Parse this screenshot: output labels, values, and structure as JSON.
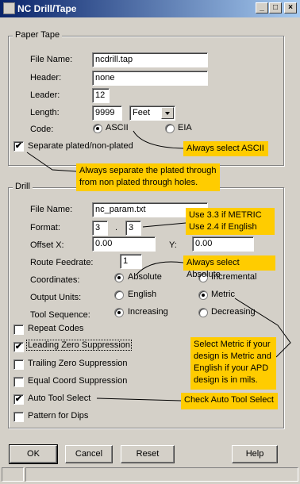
{
  "window": {
    "title": "NC Drill/Tape",
    "minimize_glyph": "_",
    "maximize_glyph": "□",
    "close_glyph": "×"
  },
  "paper_tape": {
    "legend": "Paper Tape",
    "file_name_label": "File Name:",
    "file_name_value": "ncdrill.tap",
    "header_label": "Header:",
    "header_value": "none",
    "leader_label": "Leader:",
    "leader_value": "12",
    "length_label": "Length:",
    "length_value": "9999",
    "length_unit": "Feet",
    "code_label": "Code:",
    "code_options": [
      "ASCII",
      "EIA"
    ],
    "code_selected": "ASCII",
    "separate_label": "Separate plated/non-plated",
    "separate_checked": true
  },
  "drill": {
    "legend": "Drill",
    "file_name_label": "File Name:",
    "file_name_value": "nc_param.txt",
    "format_label": "Format:",
    "format_left": "3",
    "format_separator": ".",
    "format_right": "3",
    "offset_x_label": "Offset X:",
    "offset_x_value": "0.00",
    "offset_y_label": "Y:",
    "offset_y_value": "0.00",
    "route_feedrate_label": "Route Feedrate:",
    "route_feedrate_value": "1",
    "coordinates_label": "Coordinates:",
    "coordinates_options": [
      "Absolute",
      "Incremental"
    ],
    "coordinates_selected": "Absolute",
    "output_units_label": "Output Units:",
    "output_units_options": [
      "English",
      "Metric"
    ],
    "output_units_selected": "Metric",
    "tool_sequence_label": "Tool Sequence:",
    "tool_sequence_options": [
      "Increasing",
      "Decreasing"
    ],
    "tool_sequence_selected": "Increasing",
    "checkboxes": [
      {
        "label": "Repeat Codes",
        "checked": false
      },
      {
        "label": "Leading Zero Suppression",
        "checked": true
      },
      {
        "label": "Trailing Zero Suppression",
        "checked": false
      },
      {
        "label": "Equal Coord Suppression",
        "checked": false
      },
      {
        "label": "Auto Tool Select",
        "checked": true
      },
      {
        "label": "Pattern for Dips",
        "checked": false
      }
    ]
  },
  "annotations": {
    "ascii": "Always select ASCII",
    "separate_line1": "Always separate the plated through",
    "separate_line2": "from non plated through holes.",
    "format_line1": "Use 3.3 if METRIC",
    "format_line2": "Use 2.4 if English",
    "absolute": "Always select Absolute",
    "metric_line1": "Select Metric if your",
    "metric_line2": "design is Metric and",
    "metric_line3": "English if your APD",
    "metric_line4": "design is in mils.",
    "auto_tool": "Check  Auto Tool Select",
    "color": "#ffcc00"
  },
  "buttons": {
    "ok": "OK",
    "cancel": "Cancel",
    "reset": "Reset",
    "help": "Help"
  },
  "icons": {
    "app": "app-icon",
    "checkmark": "✔"
  }
}
